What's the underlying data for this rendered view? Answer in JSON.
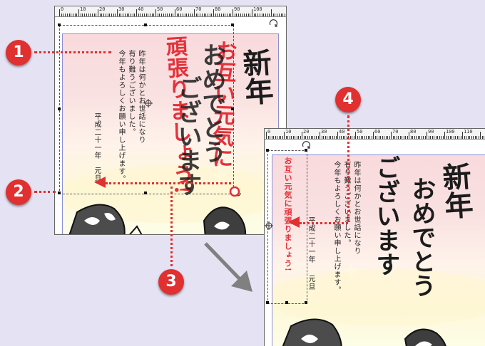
{
  "ruler": {
    "left_numbers": [
      "0",
      "10",
      "20",
      "30",
      "40",
      "50",
      "60",
      "70",
      "80",
      "90",
      "100"
    ],
    "right_numbers": [
      "0",
      "10",
      "20",
      "30",
      "40",
      "50",
      "60",
      "70",
      "80",
      "90",
      "100",
      "110"
    ]
  },
  "card": {
    "title_1": "新年",
    "title_2": "おめでとう",
    "title_3": "ございます",
    "body_lines": [
      "昨年は何かとお世話になり",
      "有り難うございました。",
      "今年もよろしくお願い申し上げます。"
    ],
    "date": "平成二十一年",
    "gantan": "元旦",
    "red_msg_1": "お互い元気に",
    "red_msg_2": "頑張りましょう!"
  },
  "markers": [
    "1",
    "2",
    "3",
    "4"
  ],
  "colors": {
    "marker_red": "#e0302f",
    "brush_red": "#e3323a",
    "background": "#e5e3f3",
    "arrow_gray": "#808080"
  }
}
